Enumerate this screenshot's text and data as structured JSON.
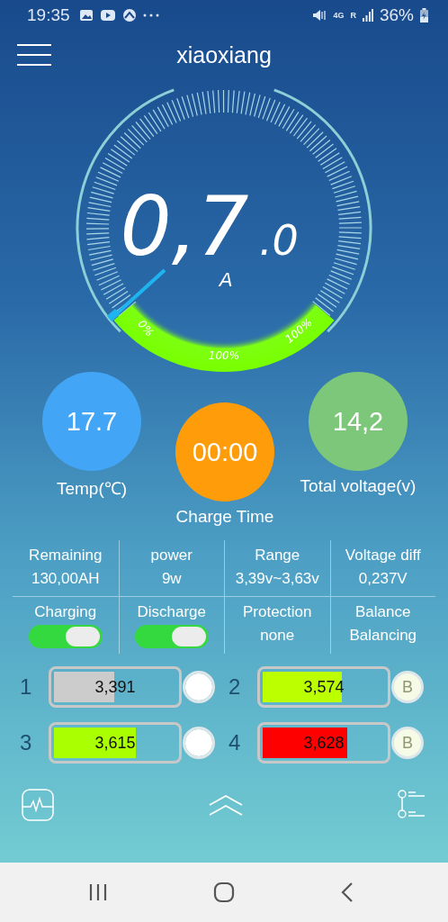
{
  "status_bar": {
    "time": "19:35",
    "network": "4G",
    "roaming": "R",
    "battery": "36%"
  },
  "header": {
    "title": "xiaoxiang"
  },
  "gauge": {
    "value": "0,7",
    "decimals": ".0",
    "unit": "A",
    "labels": [
      "0%",
      "100%",
      "100%"
    ]
  },
  "circles": [
    {
      "value": "17.7",
      "label": "Temp(℃)",
      "color": "#42a5f5"
    },
    {
      "value": "00:00",
      "label": "Charge Time",
      "color": "#ff9c0a"
    },
    {
      "value": "14,2",
      "label": "Total voltage(v)",
      "color": "#7dc77a"
    }
  ],
  "stats": [
    {
      "label": "Remaining",
      "value": "130,00AH"
    },
    {
      "label": "power",
      "value": "9w"
    },
    {
      "label": "Range",
      "value": "3,39v~3,63v"
    },
    {
      "label": "Voltage diff",
      "value": "0,237V"
    }
  ],
  "controls": [
    {
      "kind": "toggle",
      "label": "Charging",
      "on": true
    },
    {
      "kind": "toggle",
      "label": "Discharge",
      "on": true
    },
    {
      "kind": "text",
      "label": "Protection",
      "value": "none"
    },
    {
      "kind": "text",
      "label": "Balance",
      "value": "Balancing"
    }
  ],
  "cells": [
    {
      "number": "1",
      "value": "3,391",
      "level": 0.47,
      "color": "#cccccc"
    },
    {
      "number": "2",
      "value": "3,574",
      "level": 0.62,
      "color": "#bbff00",
      "badge": "B"
    },
    {
      "number": "3",
      "value": "3,615",
      "level": 0.64,
      "color": "#aaff00"
    },
    {
      "number": "4",
      "value": "3,628",
      "level": 0.66,
      "color": "#ff0000",
      "badge": "B"
    }
  ]
}
